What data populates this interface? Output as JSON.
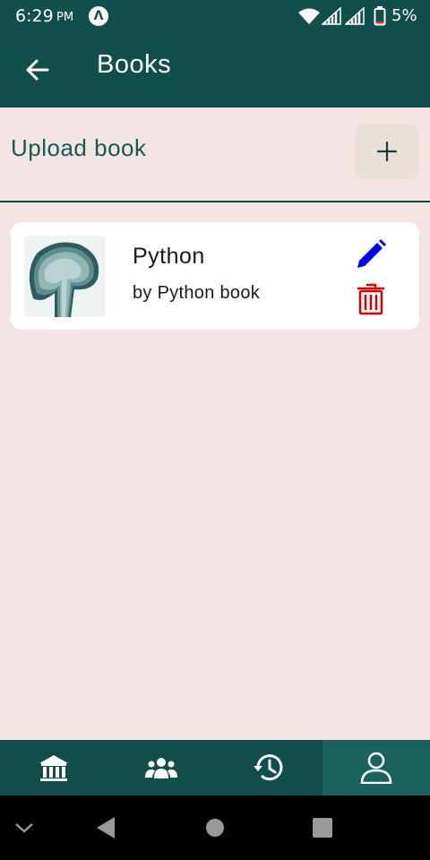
{
  "status_bar": {
    "time": "6:29",
    "ampm": "PM",
    "app_icon_letter": "Λ",
    "battery_percent": "5%",
    "icons": [
      "wifi-icon",
      "signal-icon",
      "signal-icon",
      "battery-icon"
    ]
  },
  "app_bar": {
    "back_icon": "arrow-left-icon",
    "title": "Books"
  },
  "upload": {
    "label": "Upload book",
    "add_icon": "plus-icon"
  },
  "books": [
    {
      "title": "Python",
      "author": "by Python book",
      "cover_icon": "book-cover-image",
      "edit_icon": "pencil-icon",
      "delete_icon": "trash-icon",
      "edit_color": "#0000ee",
      "delete_color": "#dd0000"
    }
  ],
  "bottom_nav": {
    "items": [
      {
        "icon": "home-icon",
        "active": false
      },
      {
        "icon": "users-icon",
        "active": false
      },
      {
        "icon": "history-icon",
        "active": false
      },
      {
        "icon": "profile-icon",
        "active": true
      }
    ]
  },
  "system_nav": {
    "items": [
      "chevron-down-icon",
      "back-triangle-icon",
      "home-circle-icon",
      "recents-square-icon"
    ]
  },
  "colors": {
    "primary": "#124e4b",
    "background": "#f4e4e3",
    "card": "#ffffff",
    "accent_label": "#175a55",
    "add_button": "#e8e0d9"
  }
}
